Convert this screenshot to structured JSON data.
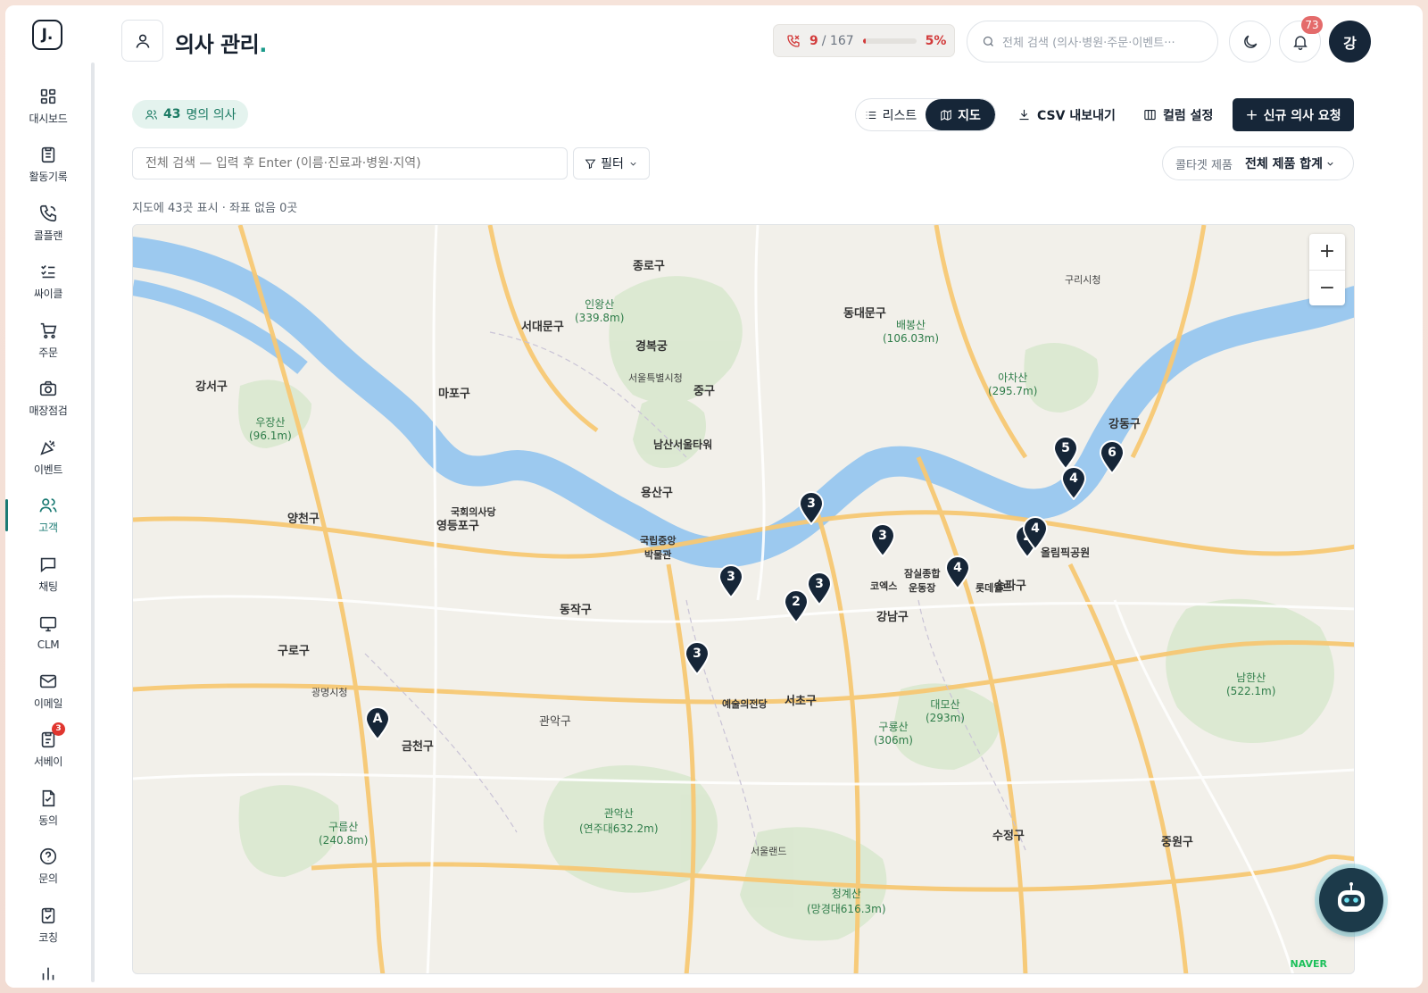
{
  "app": {
    "logo_text": "J."
  },
  "nav": [
    {
      "label": "대시보드",
      "icon": "dashboard-icon"
    },
    {
      "label": "활동기록",
      "icon": "clipboard-icon"
    },
    {
      "label": "콜플랜",
      "icon": "phone-icon"
    },
    {
      "label": "싸이클",
      "icon": "checklist-icon"
    },
    {
      "label": "주문",
      "icon": "cart-icon"
    },
    {
      "label": "매장점검",
      "icon": "camera-icon"
    },
    {
      "label": "이벤트",
      "icon": "party-icon"
    },
    {
      "label": "고객",
      "icon": "users-icon",
      "active": true
    },
    {
      "label": "채팅",
      "icon": "chat-icon"
    },
    {
      "label": "CLM",
      "icon": "monitor-icon"
    },
    {
      "label": "이메일",
      "icon": "mail-icon"
    },
    {
      "label": "서베이",
      "icon": "survey-icon",
      "badge": "3"
    },
    {
      "label": "동의",
      "icon": "document-icon"
    },
    {
      "label": "문의",
      "icon": "help-icon"
    },
    {
      "label": "코칭",
      "icon": "clipboard-check-icon"
    },
    {
      "label": "레포트",
      "icon": "bar-chart-icon"
    }
  ],
  "header": {
    "title": "의사 관리",
    "title_dot": ".",
    "call_done": "9",
    "call_total": "/ 167",
    "call_percent_label": "5%",
    "call_progress": 0.05,
    "search_placeholder": "전체 검색 (의사·병원·주문·이벤트···",
    "notification_count": "73",
    "avatar_initial": "강"
  },
  "toolbar": {
    "count_number": "43",
    "count_suffix": "명의 의사",
    "view_list": "리스트",
    "view_map": "지도",
    "csv_label": "CSV 내보내기",
    "columns_label": "컬럼 설정",
    "new_request_label": "신규 의사 요청",
    "search_placeholder": "전체 검색 — 입력 후 Enter (이름·진료과·병원·지역)",
    "filter_label": "필터",
    "product_key": "콜타겟 제품",
    "product_value": "전체 제품 합계"
  },
  "map_status": "지도에 43곳 표시 · 좌표 없음 0곳",
  "map": {
    "zoom_in": "+",
    "zoom_out": "−",
    "attribution": "NAVER",
    "markers": [
      "5",
      "6",
      "4",
      "3",
      "3",
      "2",
      "4",
      "3",
      "3",
      "2",
      "4",
      "3",
      "A"
    ],
    "labels": {
      "jongno": "종로구",
      "seodaemun": "서대문구",
      "gyeongbokgung": "경복궁",
      "mapo": "마포구",
      "junggu": "중구",
      "gangseo": "강서구",
      "namsan": "남산서울타워",
      "yongsan": "용산구",
      "yeongdeungpo": "영등포구",
      "gukhoe": "국회의사당",
      "yangcheon": "양천구",
      "guro": "구로구",
      "dongjak": "동작구",
      "museum": "국립중앙\n박물관",
      "gangnam": "강남구",
      "seocho": "서초구",
      "songpa": "송파구",
      "gangdong": "강동구",
      "dongdaemun": "동대문구",
      "olympic": "올림픽공원",
      "coex": "코엑스",
      "jamsil": "잠실종합\n운동장",
      "lotte": "롯데월드",
      "arts": "예술의전당",
      "geumcheon": "금천구",
      "gwanak": "관악산\n(연주대632.2m)",
      "gwanak_gu": "관악구",
      "suseong": "수정구",
      "jungwon": "중원구",
      "inwangsan": "인왕산\n(339.8m)",
      "baebongsan": "배봉산\n(106.03m)",
      "achasan": "아차산\n(295.7m)",
      "uijangsan": "우장산\n(96.1m)",
      "daemosan": "대모산\n(293m)",
      "guryongsan": "구룡산\n(306m)",
      "gureumsan": "구름산\n(240.8m)",
      "cheonggyesan": "청계산\n(망경대616.3m)",
      "namhansan": "남한산\n(522.1m)",
      "guri": "구리시청",
      "seoul_city": "서울특별시청",
      "gwangmyeong": "광명시청",
      "seoul_land": "서울랜드"
    }
  }
}
